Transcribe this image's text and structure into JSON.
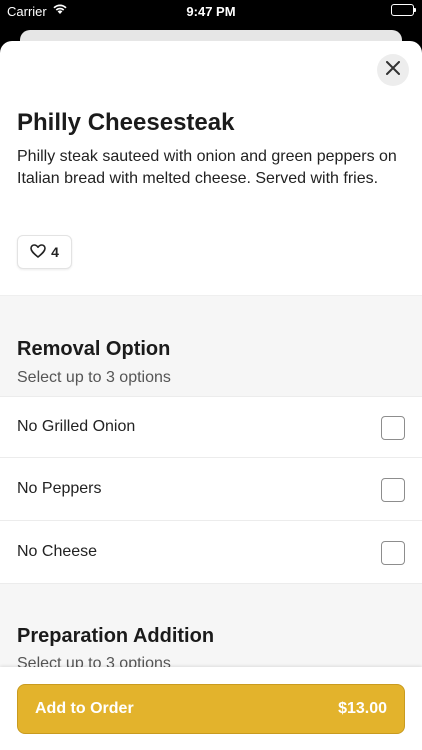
{
  "status_bar": {
    "carrier": "Carrier",
    "time": "9:47 PM"
  },
  "item": {
    "title": "Philly Cheesesteak",
    "description": "Philly steak sauteed with onion and green peppers on Italian bread with melted cheese. Served with fries.",
    "like_count": "4"
  },
  "removal": {
    "title": "Removal Option",
    "subtitle": "Select up to 3 options",
    "options": [
      {
        "label": "No Grilled Onion"
      },
      {
        "label": "No Peppers"
      },
      {
        "label": "No Cheese"
      }
    ]
  },
  "preparation": {
    "title": "Preparation Addition",
    "subtitle": "Select up to 3 options"
  },
  "order": {
    "add_label": "Add to Order",
    "price": "$13.00"
  },
  "colors": {
    "accent": "#e3b32c",
    "background": "#f6f6f6"
  },
  "icons": {
    "close": "close-icon",
    "like": "heart-icon",
    "wifi": "wifi-icon",
    "battery": "battery-icon"
  }
}
